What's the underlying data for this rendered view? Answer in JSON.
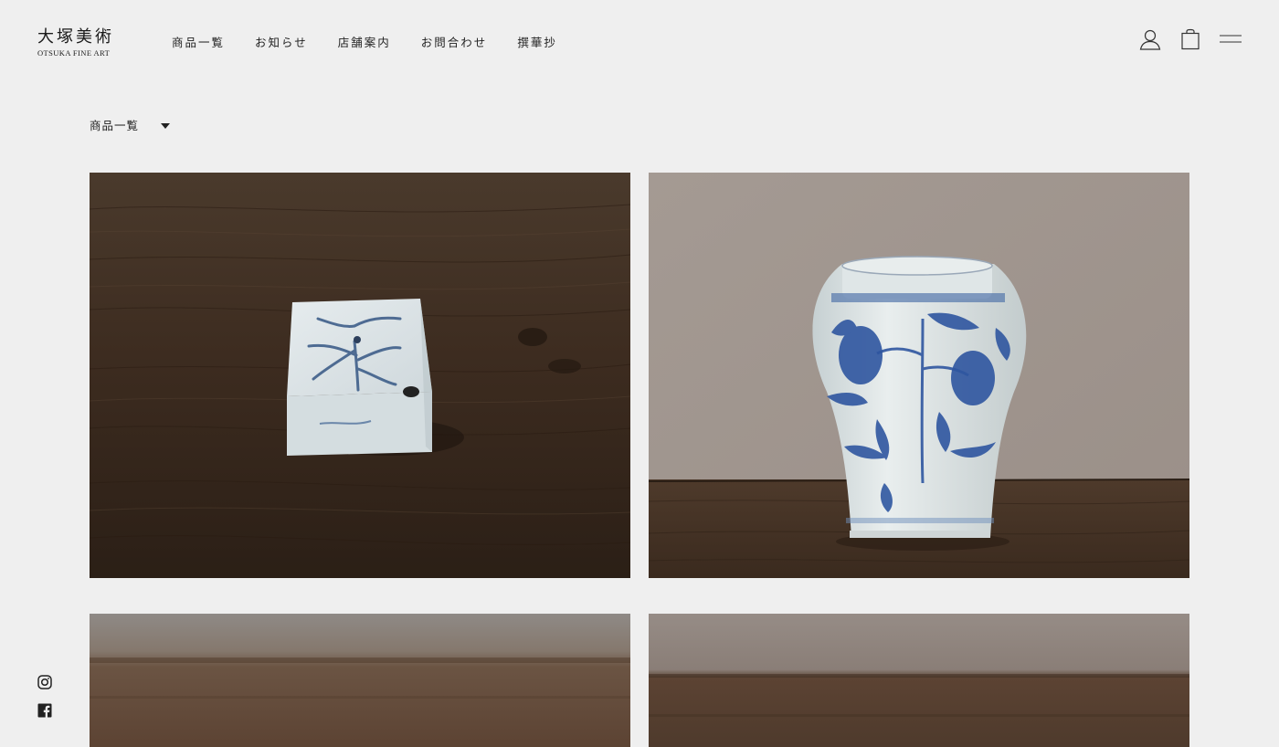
{
  "brand": {
    "name_kanji": "大塚美術",
    "name_roman": "OTSUKA FINE ART"
  },
  "nav": {
    "items": [
      {
        "label": "商品一覧"
      },
      {
        "label": "お知らせ"
      },
      {
        "label": "店舗案内"
      },
      {
        "label": "お問合わせ"
      },
      {
        "label": "撰華抄"
      }
    ]
  },
  "header_icons": {
    "account": "user-icon",
    "cart": "shopping-bag-icon",
    "menu": "hamburger-menu-icon"
  },
  "category_filter": {
    "selected": "商品一覧"
  },
  "products": [
    {
      "image": "blue-and-white porcelain rectangular block with floral motif on wooden table"
    },
    {
      "image": "blue-and-white porcelain jar with flowering branch design on wooden shelf"
    },
    {
      "image": "product photo on wooden surface (partially visible)"
    },
    {
      "image": "product photo on wooden surface (partially visible)"
    }
  ],
  "social": {
    "instagram": "instagram-icon",
    "facebook": "facebook-icon"
  },
  "colors": {
    "background": "#efefef",
    "text": "#222222"
  }
}
